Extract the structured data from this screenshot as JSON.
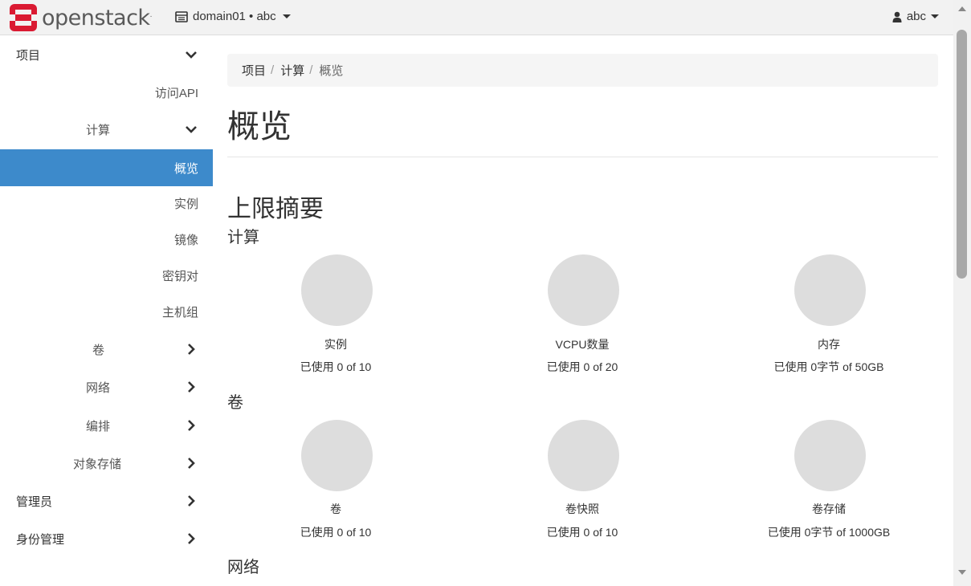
{
  "header": {
    "logo_text": "openstack",
    "logo_mark_registered": ".",
    "context": "domain01 • abc",
    "user": "abc"
  },
  "sidebar": {
    "items": [
      {
        "label": "项目",
        "chevron": "down"
      },
      {
        "label": "访问API"
      },
      {
        "label": "计算",
        "chevron": "down"
      },
      {
        "label": "概览",
        "active": true
      },
      {
        "label": "实例"
      },
      {
        "label": "镜像"
      },
      {
        "label": "密钥对"
      },
      {
        "label": "主机组"
      },
      {
        "label": "卷",
        "chevron": "right"
      },
      {
        "label": "网络",
        "chevron": "right"
      },
      {
        "label": "编排",
        "chevron": "right"
      },
      {
        "label": "对象存储",
        "chevron": "right"
      },
      {
        "label": "管理员",
        "chevron": "right"
      },
      {
        "label": "身份管理",
        "chevron": "right"
      }
    ]
  },
  "breadcrumb": [
    "项目",
    "计算",
    "概览"
  ],
  "breadcrumb_sep": "/",
  "page_title": "概览",
  "limits_title": "上限摘要",
  "sections": [
    {
      "title": "计算",
      "charts": [
        {
          "name": "实例",
          "used": "已使用 0 of 10"
        },
        {
          "name": "VCPU数量",
          "used": "已使用 0 of 20"
        },
        {
          "name": "内存",
          "used": "已使用 0字节 of 50GB"
        }
      ]
    },
    {
      "title": "卷",
      "charts": [
        {
          "name": "卷",
          "used": "已使用 0 of 10"
        },
        {
          "name": "卷快照",
          "used": "已使用 0 of 10"
        },
        {
          "name": "卷存储",
          "used": "已使用 0字节 of 1000GB"
        }
      ]
    },
    {
      "title": "网络",
      "charts": []
    }
  ],
  "colors": {
    "active_nav": "#3d8acb",
    "logo_red": "#da1a32",
    "pie_empty": "#dddddd"
  }
}
